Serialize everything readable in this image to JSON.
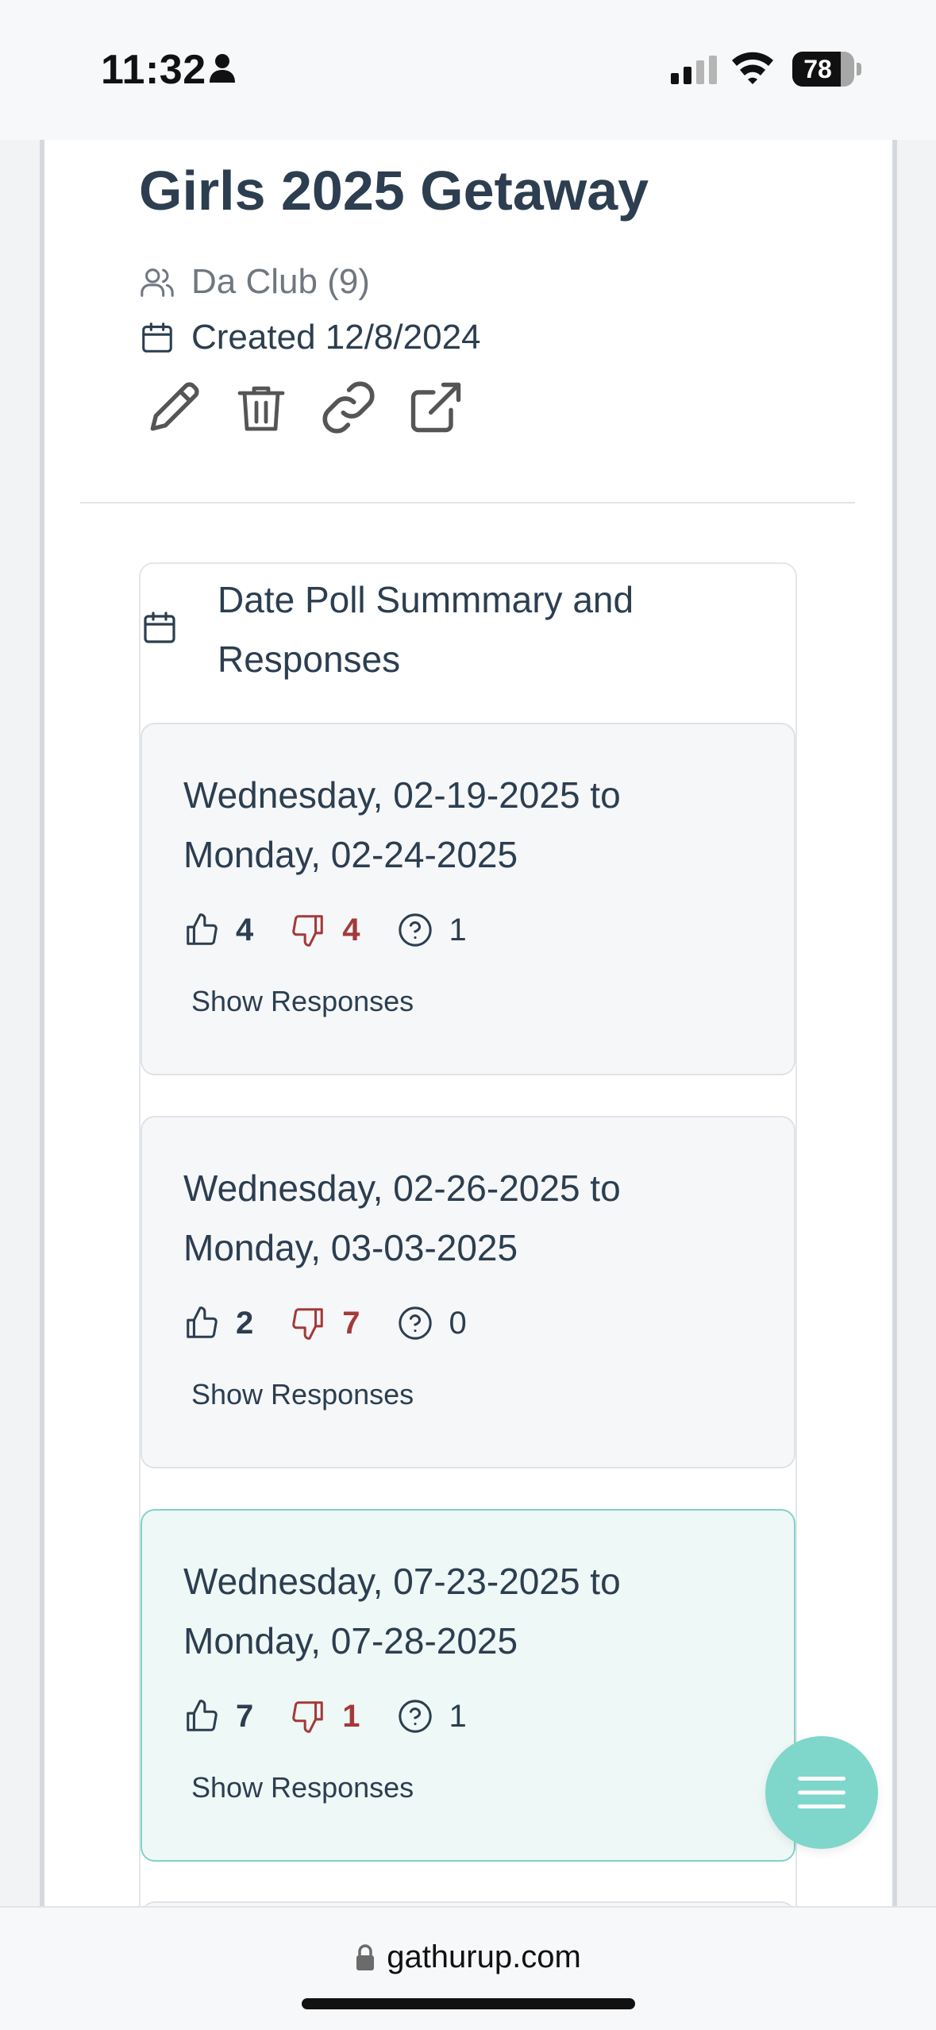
{
  "status_bar": {
    "time": "11:32",
    "battery": "78",
    "battery_level": 0.78,
    "icons": [
      "person-icon",
      "signal-icon",
      "wifi-icon",
      "battery-icon"
    ]
  },
  "event": {
    "title": "Girls 2025 Getaway",
    "group": "Da Club (9)",
    "created": "Created 12/8/2024",
    "actions": [
      "edit-icon",
      "trash-icon",
      "link-icon",
      "external-link-icon"
    ]
  },
  "poll": {
    "header": "Date Poll Summmary and Responses",
    "options": [
      {
        "line1": "Wednesday, 02-19-2025 to",
        "line2": "Monday, 02-24-2025",
        "yes": "4",
        "no": "4",
        "maybe": "1",
        "show_label": "Show Responses",
        "highlighted": false
      },
      {
        "line1": "Wednesday, 02-26-2025 to",
        "line2": "Monday, 03-03-2025",
        "yes": "2",
        "no": "7",
        "maybe": "0",
        "show_label": "Show Responses",
        "highlighted": false
      },
      {
        "line1": "Wednesday, 07-23-2025 to",
        "line2": "Monday, 07-28-2025",
        "yes": "7",
        "no": "1",
        "maybe": "1",
        "show_label": "Show Responses",
        "highlighted": true
      }
    ]
  },
  "browser": {
    "url": "gathurup.com"
  },
  "colors": {
    "text": "#2c3e50",
    "no_red": "#a33a3a",
    "accent_teal": "#7fd6cb",
    "highlight_bg": "#eef8f6"
  }
}
